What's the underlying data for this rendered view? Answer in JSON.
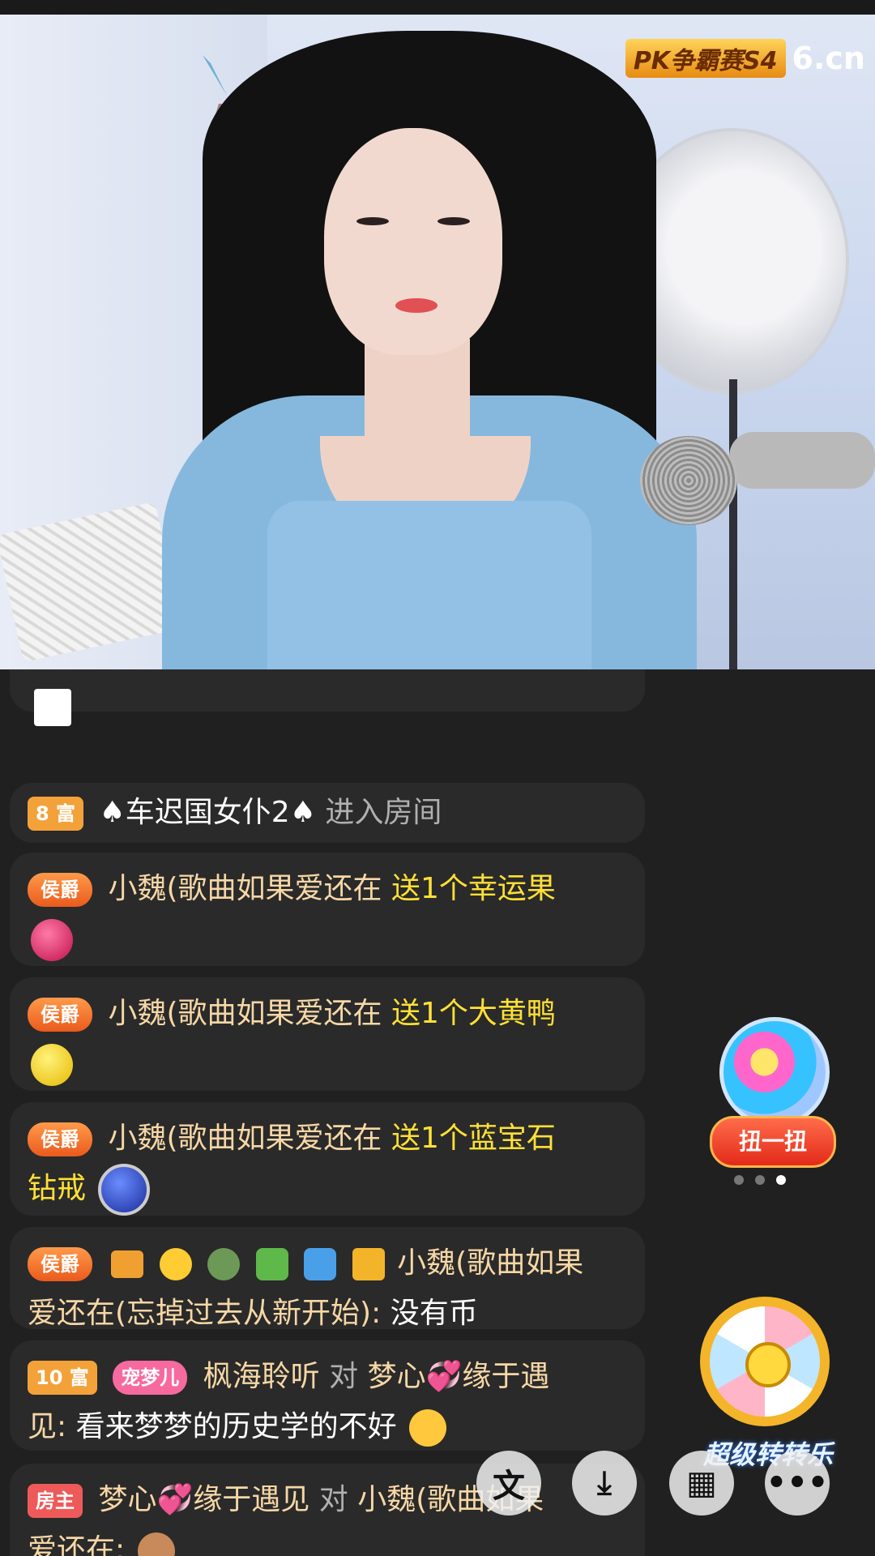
{
  "video": {
    "logo_badge": "PK争霸赛S4",
    "brand": "6.cn"
  },
  "chat": {
    "messages": [
      {
        "partial": true
      },
      {
        "tag": "8 富",
        "name": "♠车迟国女仆2♠",
        "action": "进入房间"
      },
      {
        "tag": "侯爵",
        "name": "小魏(歌曲如果爱还在",
        "action": "送1个幸运果"
      },
      {
        "tag": "侯爵",
        "name": "小魏(歌曲如果爱还在",
        "action": "送1个大黄鸭"
      },
      {
        "tag": "侯爵",
        "name": "小魏(歌曲如果爱还在",
        "action_line1": "送1个蓝宝石",
        "action_line2": "钻戒"
      },
      {
        "tag": "侯爵",
        "name_line1": "小魏(歌曲如果",
        "name_line2": "爱还在(忘掉过去从新开始):",
        "text": "没有币"
      },
      {
        "tag": "10 富",
        "pet_tag": "宠梦儿",
        "speaker": "枫海聆听",
        "to": "对",
        "target_line1": "梦心💞缘于遇",
        "target_line2": "见:",
        "text": "看来梦梦的历史学的不好"
      },
      {
        "tag": "房主",
        "speaker": "梦心💞缘于遇见",
        "to": "对",
        "target_line1": "小魏(歌曲如果",
        "target_line2": "爱还在:"
      }
    ]
  },
  "widgets": {
    "capsule_button": "扭一扭",
    "wheel_label": "超级转转乐"
  },
  "colors": {
    "background": "#202020",
    "bubble": "#2a2a2a",
    "name": "#f6d7a6",
    "gift": "#ffe036"
  }
}
